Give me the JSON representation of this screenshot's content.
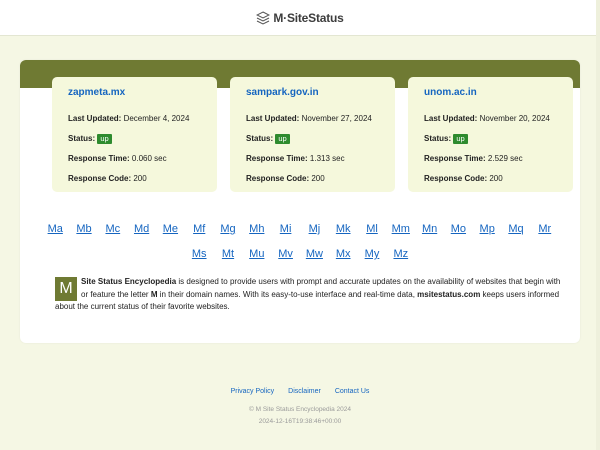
{
  "header": {
    "logo_text": "M·SiteStatus",
    "logo_icon": "cube-stack-icon"
  },
  "sites": [
    {
      "domain": "zapmeta.mx",
      "last_updated_label": "Last Updated:",
      "last_updated": "December 4, 2024",
      "status_label": "Status:",
      "status": "up",
      "response_time_label": "Response Time:",
      "response_time": "0.060 sec",
      "response_code_label": "Response Code:",
      "response_code": "200"
    },
    {
      "domain": "sampark.gov.in",
      "last_updated_label": "Last Updated:",
      "last_updated": "November 27, 2024",
      "status_label": "Status:",
      "status": "up",
      "response_time_label": "Response Time:",
      "response_time": "1.313 sec",
      "response_code_label": "Response Code:",
      "response_code": "200"
    },
    {
      "domain": "unom.ac.in",
      "last_updated_label": "Last Updated:",
      "last_updated": "November 20, 2024",
      "status_label": "Status:",
      "status": "up",
      "response_time_label": "Response Time:",
      "response_time": "2.529 sec",
      "response_code_label": "Response Code:",
      "response_code": "200"
    }
  ],
  "letters_row1": [
    "Ma",
    "Mb",
    "Mc",
    "Md",
    "Me",
    "Mf",
    "Mg",
    "Mh",
    "Mi",
    "Mj",
    "Mk",
    "Ml",
    "Mm",
    "Mn",
    "Mo",
    "Mp",
    "Mq",
    "Mr"
  ],
  "letters_row2": [
    "Ms",
    "Mt",
    "Mu",
    "Mv",
    "Mw",
    "Mx",
    "My",
    "Mz"
  ],
  "about": {
    "dropcap": "M",
    "title": "Site Status Encyclopedia",
    "text1": " is designed to provide users with prompt and accurate updates on the availability of websites that begin with or feature the letter ",
    "letter": "M",
    "text2": " in their domain names. With its easy-to-use interface and real-time data, ",
    "brand": "msitestatus.com",
    "text3": " keeps users informed about the current status of their favorite websites."
  },
  "footer": {
    "links": [
      "Privacy Policy",
      "Disclaimer",
      "Contact Us"
    ],
    "copyright": "© M Site Status Encyclopedia 2024",
    "timestamp": "2024-12-16T19:38:46+00:00"
  },
  "colors": {
    "accent_olive": "#6f7a33",
    "card_bg": "#f5f8dc",
    "page_bg": "#f5f7e4",
    "link": "#1565c0",
    "status_up": "#2e8b2e"
  }
}
